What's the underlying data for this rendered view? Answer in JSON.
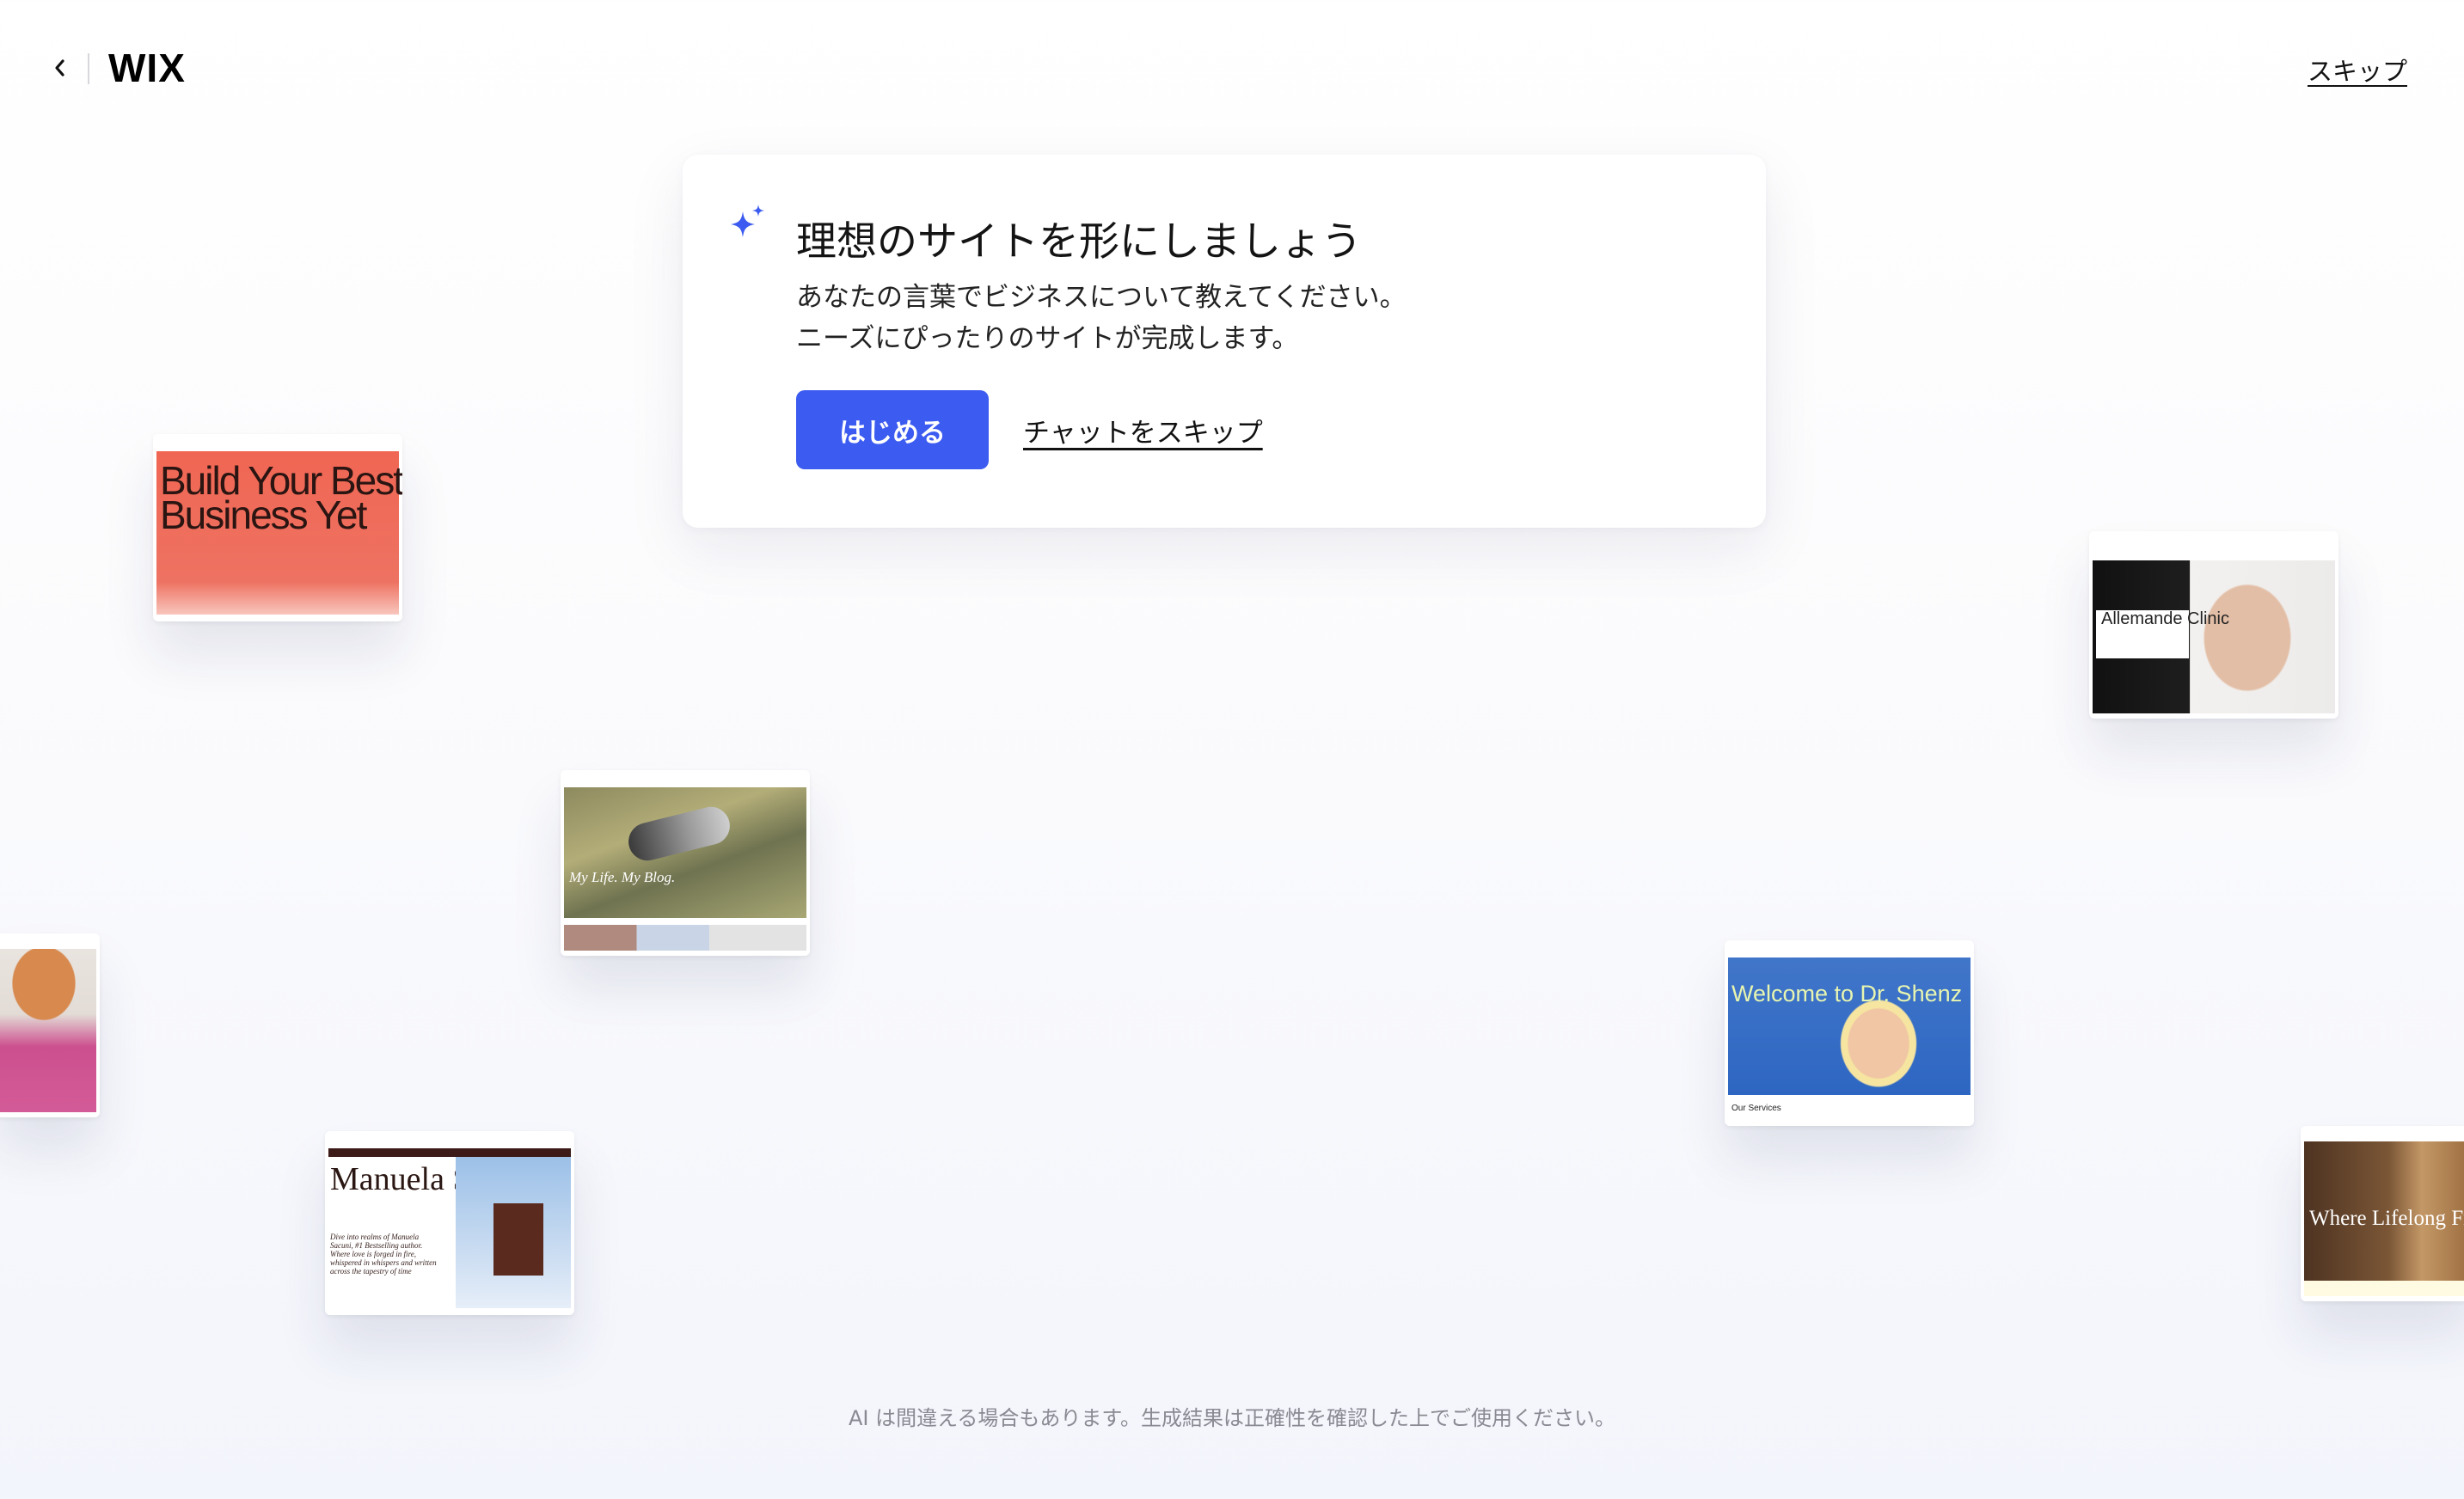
{
  "header": {
    "back_icon": "chevron-left-icon",
    "logo": "WIX",
    "skip_label": "スキップ"
  },
  "card": {
    "icon": "sparkle-icon",
    "title": "理想のサイトを形にしましょう",
    "description_line1": "あなたの言葉でビジネスについて教えてください。",
    "description_line2": "ニーズにぴったりのサイトが完成します。",
    "start_label": "はじめる",
    "skip_chat_label": "チャットをスキップ"
  },
  "thumbnails": {
    "business": "Build Your Best Business Yet",
    "blog": "My Life. My Blog.",
    "author": "Manuela Sacuni",
    "author_blurb": "Dive into realms of Manuela Sacuni, #1 Bestselling author. Where love is forged in fire, whispered in whispers and written across the tapestry of time",
    "clinic": "Allemande Clinic",
    "doctor": "Welcome to Dr. Shenz",
    "doctor_services": "Our Services",
    "dog": "Where Lifelong Friendship Begins"
  },
  "colors": {
    "accent": "#3c5bf0",
    "sparkle": "#3c5bf0"
  },
  "disclaimer": "AI は間違える場合もあります。生成結果は正確性を確認した上でご使用ください。"
}
